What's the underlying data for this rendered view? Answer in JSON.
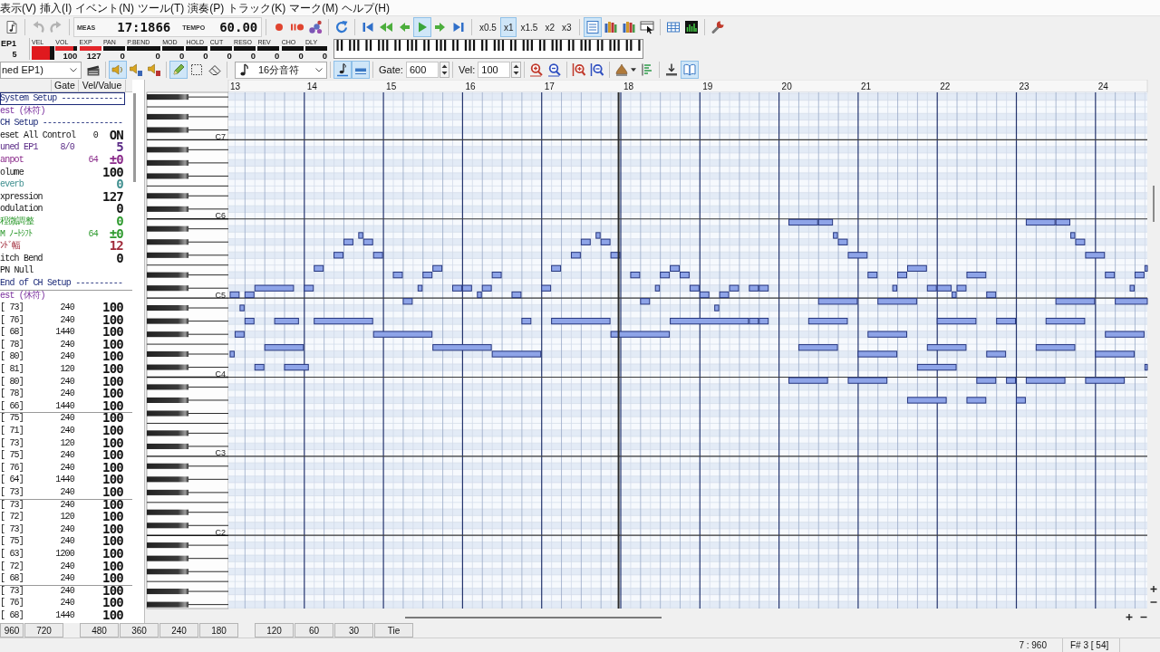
{
  "menu": [
    "表示(V)",
    "挿入(I)",
    "イベント(N)",
    "ツール(T)",
    "演奏(P)",
    "トラック(K)",
    "マーク(M)",
    "ヘルプ(H)"
  ],
  "toolbar_top": {
    "leading": [
      [
        {
          "kind": "document",
          "disabled": false
        }
      ],
      [
        {
          "kind": "undo",
          "disabled": true
        },
        {
          "kind": "redo",
          "disabled": true
        }
      ]
    ],
    "counter": {
      "meas_label": "MEAS",
      "meas": "17:1866",
      "tempo_label": "TEMPO",
      "tempo": "60.00"
    },
    "trailing": [
      [
        {
          "kind": "record",
          "on": false
        },
        {
          "kind": "recpause",
          "on": false
        },
        {
          "kind": "plugin",
          "on": false
        }
      ],
      [
        {
          "kind": "loop",
          "on": false
        }
      ],
      [
        {
          "kind": "start",
          "on": false
        },
        {
          "kind": "rewind",
          "on": false
        },
        {
          "kind": "back",
          "on": false
        },
        {
          "kind": "play",
          "on": true
        },
        {
          "kind": "forward",
          "on": false
        },
        {
          "kind": "end",
          "on": false
        }
      ],
      [
        {
          "kind": "speed",
          "label": "x0.5",
          "selected": false
        },
        {
          "kind": "speed",
          "label": "x1",
          "selected": true
        },
        {
          "kind": "speed",
          "label": "x1.5",
          "selected": false
        },
        {
          "kind": "speed",
          "label": "x2",
          "selected": false
        },
        {
          "kind": "speed",
          "label": "x3",
          "selected": false
        }
      ],
      [
        {
          "kind": "list",
          "on": true
        },
        {
          "kind": "tracks",
          "on": false
        },
        {
          "kind": "tracks",
          "on": false
        },
        {
          "kind": "cursor",
          "on": false
        }
      ],
      [
        {
          "kind": "table",
          "on": false
        },
        {
          "kind": "meter",
          "on": false
        }
      ],
      [
        {
          "kind": "wrench",
          "on": false
        }
      ]
    ]
  },
  "track": {
    "name": "EP1",
    "number": "5"
  },
  "meters": [
    {
      "kind": "velocity",
      "label": "VEL",
      "level": 0.8
    },
    {
      "kind": "bar",
      "label": "VOL",
      "level": 0.82,
      "reading": "100"
    },
    {
      "kind": "bar",
      "label": "EXP",
      "level": 1,
      "reading": "127"
    },
    {
      "kind": "bar",
      "label": "PAN",
      "reading": "0"
    },
    {
      "kind": "bar",
      "label": "P.BEND",
      "reading": "0"
    },
    {
      "kind": "bar",
      "label": "MOD",
      "reading": "0"
    },
    {
      "kind": "bar",
      "label": "HOLD",
      "reading": "0"
    },
    {
      "kind": "bar",
      "label": "CUT",
      "reading": "0"
    },
    {
      "kind": "bar",
      "label": "RESO",
      "reading": "0"
    },
    {
      "kind": "bar",
      "label": "REV",
      "reading": "0"
    },
    {
      "kind": "bar",
      "label": "CHO",
      "reading": "0"
    },
    {
      "kind": "bar",
      "label": "DLY",
      "reading": "0"
    }
  ],
  "toolbar_edit": {
    "track": {
      "value": "ned EP1)"
    },
    "modes": [
      [
        {
          "kind": "clapper",
          "on": false
        }
      ],
      [
        {
          "kind": "speaker",
          "on": true
        },
        {
          "kind": "speakers",
          "on": false
        },
        {
          "kind": "speakera",
          "on": false
        }
      ],
      [
        {
          "kind": "pencil",
          "on": true
        },
        {
          "kind": "select",
          "on": false
        },
        {
          "kind": "eraser",
          "on": false
        }
      ]
    ],
    "note_length": {
      "value": "16分音符"
    },
    "inputs": [
      [
        {
          "kind": "insert",
          "on": true
        },
        {
          "kind": "length",
          "on": true
        }
      ]
    ],
    "gate": {
      "label": "Gate:",
      "value": "600"
    },
    "velocity": {
      "label": "Vel:",
      "value": "100"
    },
    "views": [
      [
        {
          "kind": "zoomin",
          "on": false
        },
        {
          "kind": "zoomout",
          "on": false
        }
      ],
      [
        {
          "kind": "vzoomin",
          "on": false
        },
        {
          "kind": "vzoomout",
          "on": false
        }
      ],
      [
        {
          "kind": "hill",
          "on": false
        },
        {
          "kind": "steps",
          "on": false
        }
      ],
      [
        {
          "kind": "import",
          "on": false
        },
        {
          "kind": "book",
          "on": true
        }
      ]
    ]
  },
  "event_list": {
    "columns": [
      "Gate",
      "Vel/Value"
    ],
    "groups": [
      {
        "rows": [
          {
            "kind": "section",
            "name": "System Setup -------------",
            "selected": true
          },
          {
            "kind": "rest",
            "name": "est (休符)",
            "selected": false
          },
          {
            "kind": "section",
            "name": "CH Setup -----------------",
            "selected": false
          },
          {
            "kind": "control",
            "name": "eset All Control",
            "param": "0",
            "value": "ON",
            "selected": false
          },
          {
            "kind": "program",
            "name": "uned EP1",
            "gate": "8/0",
            "value": "5",
            "selected": false
          },
          {
            "kind": "pan",
            "name": "anpot",
            "param": "64",
            "value": "±0",
            "selected": false
          },
          {
            "kind": "control",
            "name": "olume",
            "value": "100",
            "selected": false
          },
          {
            "kind": "effect",
            "name": "everb",
            "value": "0",
            "selected": false
          },
          {
            "kind": "control",
            "name": "xpression",
            "value": "127",
            "selected": false
          },
          {
            "kind": "control",
            "name": "odulation",
            "value": "0",
            "selected": false
          },
          {
            "kind": "tuning",
            "name": "程微調整",
            "value": "0",
            "selected": false
          },
          {
            "kind": "tuning",
            "name": "M ﾉｰﾄｼﾌﾄ",
            "param": "64",
            "value": "±0",
            "selected": false
          },
          {
            "kind": "range",
            "name": "ﾝﾄﾞ幅",
            "value": "12",
            "selected": false
          },
          {
            "kind": "control",
            "name": "itch Bend",
            "value": "0",
            "selected": false
          },
          {
            "kind": "control",
            "name": "PN Null",
            "selected": false
          },
          {
            "kind": "section",
            "name": "End of CH Setup ----------",
            "selected": false
          }
        ]
      },
      {
        "rows": [
          {
            "kind": "rest",
            "name": "est (休符)",
            "selected": false
          },
          {
            "kind": "note",
            "name": "[ 73]",
            "gate": "240",
            "value": "100",
            "selected": false
          },
          {
            "kind": "note",
            "name": "[ 76]",
            "gate": "240",
            "value": "100",
            "selected": false
          },
          {
            "kind": "note",
            "name": "[ 68]",
            "gate": "1440",
            "value": "100",
            "selected": false
          },
          {
            "kind": "note",
            "name": "[ 78]",
            "gate": "240",
            "value": "100",
            "selected": false
          },
          {
            "kind": "note",
            "name": "[ 80]",
            "gate": "240",
            "value": "100",
            "selected": false
          },
          {
            "kind": "note",
            "name": "[ 81]",
            "gate": "120",
            "value": "100",
            "selected": false
          },
          {
            "kind": "note",
            "name": "[ 80]",
            "gate": "240",
            "value": "100",
            "selected": false
          },
          {
            "kind": "note",
            "name": "[ 78]",
            "gate": "240",
            "value": "100",
            "selected": false
          },
          {
            "kind": "note",
            "name": "[ 66]",
            "gate": "1440",
            "value": "100",
            "selected": false
          }
        ]
      },
      {
        "rows": [
          {
            "kind": "note",
            "name": "[ 75]",
            "gate": "240",
            "value": "100",
            "selected": false
          },
          {
            "kind": "note",
            "name": "[ 71]",
            "gate": "240",
            "value": "100",
            "selected": false
          },
          {
            "kind": "note",
            "name": "[ 73]",
            "gate": "120",
            "value": "100",
            "selected": false
          },
          {
            "kind": "note",
            "name": "[ 75]",
            "gate": "240",
            "value": "100",
            "selected": false
          },
          {
            "kind": "note",
            "name": "[ 76]",
            "gate": "240",
            "value": "100",
            "selected": false
          },
          {
            "kind": "note",
            "name": "[ 64]",
            "gate": "1440",
            "value": "100",
            "selected": false
          },
          {
            "kind": "note",
            "name": "[ 73]",
            "gate": "240",
            "value": "100",
            "selected": false
          }
        ]
      },
      {
        "rows": [
          {
            "kind": "note",
            "name": "[ 73]",
            "gate": "240",
            "value": "100",
            "selected": false
          },
          {
            "kind": "note",
            "name": "[ 72]",
            "gate": "120",
            "value": "100",
            "selected": false
          },
          {
            "kind": "note",
            "name": "[ 73]",
            "gate": "240",
            "value": "100",
            "selected": false
          },
          {
            "kind": "note",
            "name": "[ 75]",
            "gate": "240",
            "value": "100",
            "selected": false
          },
          {
            "kind": "note",
            "name": "[ 63]",
            "gate": "1200",
            "value": "100",
            "selected": false
          },
          {
            "kind": "note",
            "name": "[ 72]",
            "gate": "240",
            "value": "100",
            "selected": false
          },
          {
            "kind": "note",
            "name": "[ 68]",
            "gate": "240",
            "value": "100",
            "selected": false
          }
        ]
      },
      {
        "rows": [
          {
            "kind": "note",
            "name": "[ 73]",
            "gate": "240",
            "value": "100",
            "selected": false
          },
          {
            "kind": "note",
            "name": "[ 76]",
            "gate": "240",
            "value": "100",
            "selected": false
          },
          {
            "kind": "note",
            "name": "[ 68]",
            "gate": "1440",
            "value": "100",
            "selected": false
          }
        ]
      }
    ]
  },
  "piano_roll": {
    "measure_numbers": [
      "13",
      "14",
      "15",
      "16",
      "17",
      "18",
      "19",
      "20",
      "21",
      "22",
      "23",
      "24"
    ],
    "octave_labels": [
      "C7",
      "C6",
      "C5",
      "C4",
      "C3",
      "C2"
    ]
  },
  "length_buttons": [
    {
      "kind": "length",
      "label": "960"
    },
    {
      "kind": "length",
      "label": "720"
    },
    {
      "kind": "blank"
    },
    {
      "kind": "length",
      "label": "480"
    },
    {
      "kind": "length",
      "label": "360"
    },
    {
      "kind": "length",
      "label": "240"
    },
    {
      "kind": "length",
      "label": "180"
    },
    {
      "kind": "blank"
    },
    {
      "kind": "length",
      "label": "120"
    },
    {
      "kind": "length",
      "label": "60"
    },
    {
      "kind": "length",
      "label": "30"
    },
    {
      "kind": "length",
      "label": "Tie"
    }
  ],
  "status_bar": {
    "position": "7 : 960",
    "pitch": "F# 3 [ 54]"
  }
}
